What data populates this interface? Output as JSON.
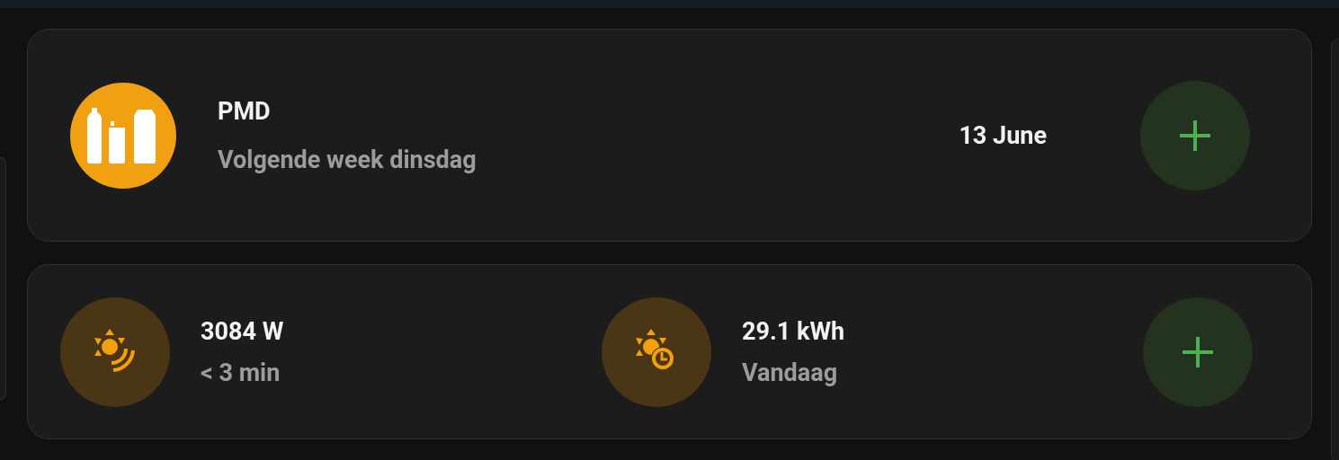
{
  "waste": {
    "title": "PMD",
    "subtitle": "Volgende week dinsdag",
    "date": "13 June"
  },
  "solar": {
    "sensors": [
      {
        "value": "3084 W",
        "label": "< 3 min"
      },
      {
        "value": "29.1 kWh",
        "label": "Vandaag"
      }
    ]
  }
}
